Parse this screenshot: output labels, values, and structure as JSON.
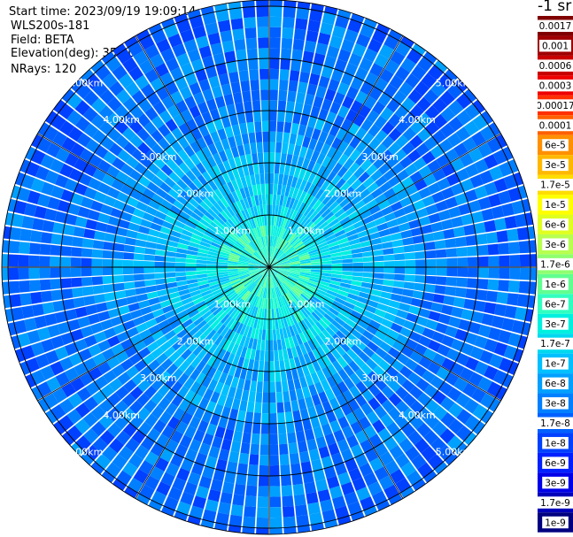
{
  "info": {
    "start_time": "Start time: 2023/09/19 19:09:14",
    "instrument": "WLS200s-181",
    "field": "Field: BETA",
    "elevation": "Elevation(deg): 35.30",
    "nrays": "NRays: 120"
  },
  "unit_label": "-1 sr",
  "chart_data": {
    "type": "heatmap",
    "projection": "polar-ppi",
    "field": "BETA",
    "nrays": 120,
    "max_range_km": 6,
    "range_rings_km": [
      1,
      2,
      3,
      4,
      5
    ],
    "ring_labels": [
      "1.00km",
      "2.00km",
      "3.00km",
      "4.00km",
      "5.00km"
    ],
    "spoke_angles_deg": [
      0,
      30,
      60,
      90,
      120,
      150,
      180,
      210,
      240,
      270,
      300,
      330
    ],
    "colorbar": {
      "labels": [
        "0.0017",
        "0.001",
        "0.0006",
        "0.0003",
        "0.00017",
        "0.0001",
        "6e-5",
        "3e-5",
        "1.7e-5",
        "1e-5",
        "6e-6",
        "3e-6",
        "1.7e-6",
        "1e-6",
        "6e-7",
        "3e-7",
        "1.7e-7",
        "1e-7",
        "6e-8",
        "3e-8",
        "1.7e-8",
        "1e-8",
        "6e-9",
        "3e-9",
        "1.7e-9",
        "1e-9"
      ],
      "colors": [
        "#800000",
        "#a00000",
        "#c80000",
        "#ee0000",
        "#ff3000",
        "#ff6000",
        "#ff9000",
        "#ffb800",
        "#ffdd00",
        "#ffff00",
        "#e0ff20",
        "#b8ff50",
        "#90ff70",
        "#60ff90",
        "#30ffc0",
        "#00f0e0",
        "#00d8f0",
        "#00c0ff",
        "#00a0ff",
        "#0080ff",
        "#0060ff",
        "#0040ff",
        "#0020ff",
        "#0000e8",
        "#0000b8",
        "#000080"
      ]
    }
  }
}
